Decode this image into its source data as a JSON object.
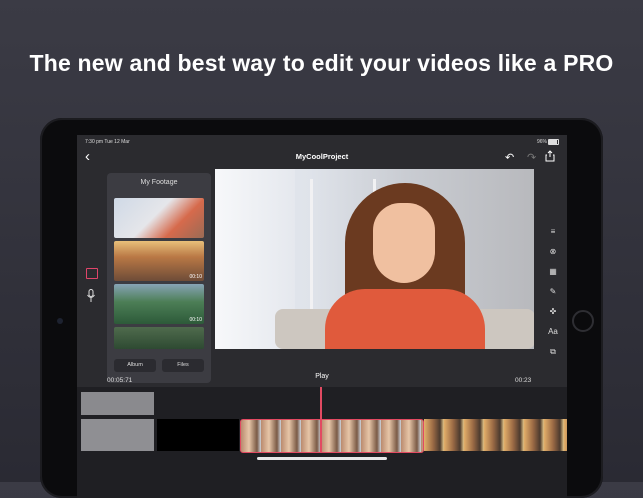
{
  "headline": "The new and best way to edit your videos like a PRO",
  "status": {
    "time": "7:30 pm  Tue 12 Mar",
    "battery": "96%"
  },
  "nav": {
    "title": "MyCoolProject",
    "back": "‹",
    "undo": "↶",
    "redo": "↷"
  },
  "footage": {
    "title": "My Footage",
    "thumbs": [
      {
        "duration": ""
      },
      {
        "duration": "00:10"
      },
      {
        "duration": "00:10"
      },
      {
        "duration": ""
      }
    ],
    "album_label": "Album",
    "files_label": "Files"
  },
  "player": {
    "current_time": "00:05:71",
    "play_label": "Play",
    "end_time": "00:23"
  },
  "tools": [
    "≡",
    "⊗",
    "▦",
    "✎",
    "✜",
    "Aa",
    "⧉"
  ],
  "colors": {
    "accent": "#e24a62",
    "background": "#2b2b2f"
  }
}
